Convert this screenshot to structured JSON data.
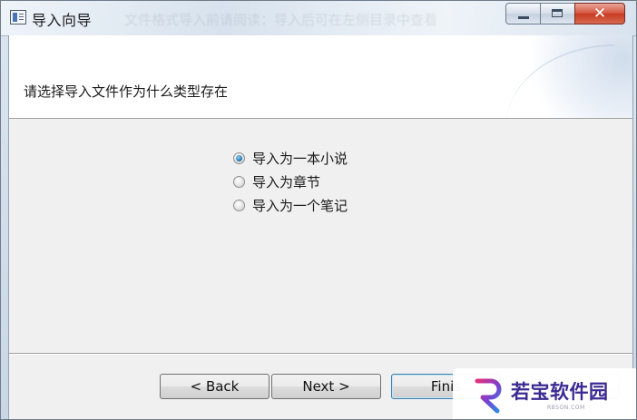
{
  "window": {
    "title": "导入向导",
    "title_ghost": "文件格式导入前请阅读：导入后可在左侧目录中查看"
  },
  "header": {
    "subtitle": "请选择导入文件作为什么类型存在"
  },
  "options": [
    {
      "label": "导入为一本小说",
      "checked": true
    },
    {
      "label": "导入为章节",
      "checked": false
    },
    {
      "label": "导入为一个笔记",
      "checked": false
    }
  ],
  "buttons": {
    "back": "< Back",
    "next": "Next >",
    "finish": "Finis",
    "cancel": ""
  },
  "watermark": {
    "text": "若宝软件园",
    "url": "RBSON.COM"
  },
  "colors": {
    "accent": "#1d6fa8",
    "close": "#c63a22",
    "watermark": "#3b2a92"
  }
}
